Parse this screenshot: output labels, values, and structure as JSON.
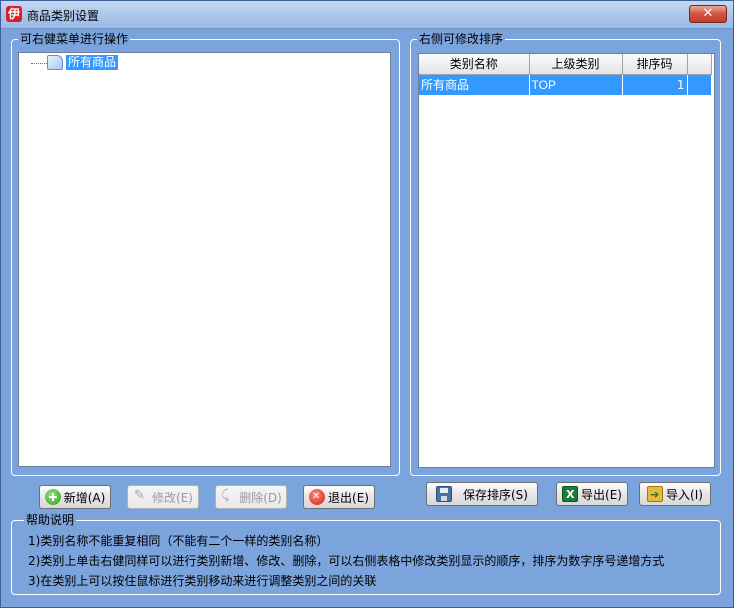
{
  "window": {
    "app_icon": "伊",
    "title": "商品类别设置",
    "close_glyph": "✕"
  },
  "left_panel": {
    "legend": "可右健菜单进行操作",
    "tree": {
      "root_label": "所有商品",
      "root_icon": "book-icon"
    }
  },
  "right_panel": {
    "legend": "右侧可修改排序",
    "columns": [
      "类别名称",
      "上级类别",
      "排序码"
    ],
    "rows": [
      {
        "name": "所有商品",
        "parent": "TOP",
        "order": "1"
      }
    ]
  },
  "left_buttons": {
    "add": "新增(A)",
    "edit": "修改(E)",
    "delete": "删除(D)",
    "exit": "退出(E)"
  },
  "right_buttons": {
    "save": "保存排序(S)",
    "export": "导出(E)",
    "import": "导入(I)"
  },
  "help": {
    "legend": "帮助说明",
    "lines": [
      "1)类别名称不能重复相同（不能有二个一样的类别名称）",
      "2)类别上单击右健同样可以进行类别新增、修改、删除，可以右侧表格中修改类别显示的顺序，排序为数字序号递增方式",
      "3)在类别上可以按住鼠标进行类别移动来进行调整类别之间的关联"
    ]
  },
  "colors": {
    "window_bg": "#7ba3dc",
    "selection": "#3399ff"
  }
}
